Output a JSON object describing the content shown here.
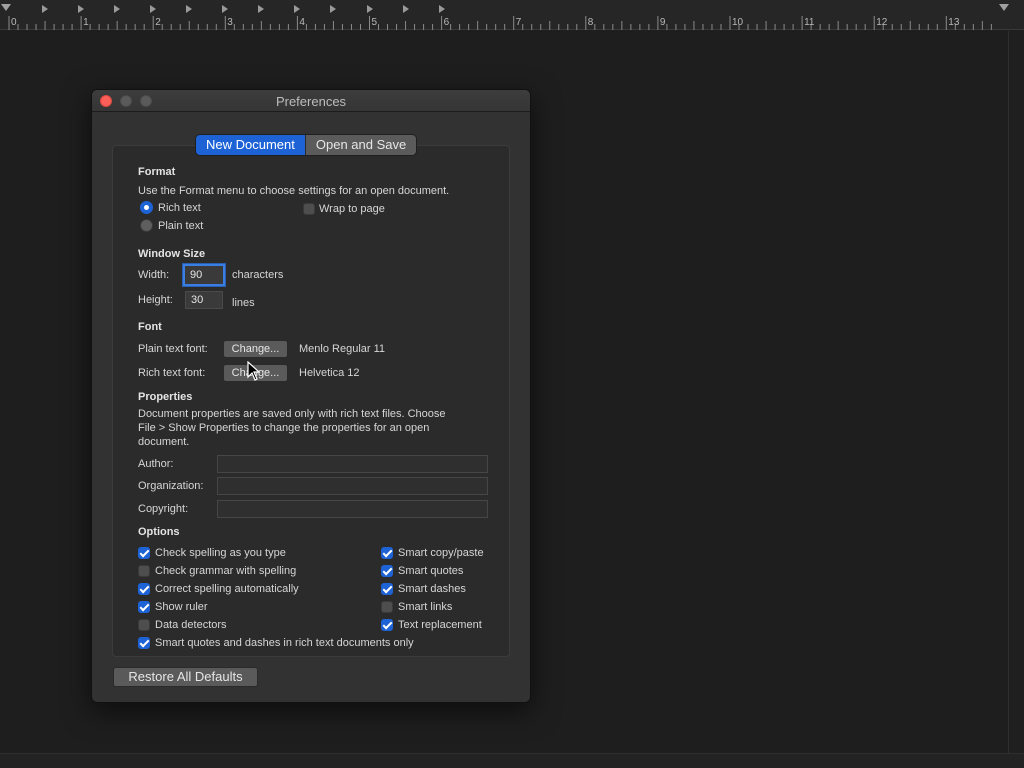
{
  "ruler": {
    "numbers": [
      "0",
      "1",
      "2",
      "3",
      "4",
      "5",
      "6",
      "7",
      "8",
      "9",
      "10",
      "11",
      "12",
      "13"
    ]
  },
  "document": {
    "text": ""
  },
  "prefs": {
    "title": "Preferences",
    "tabs": {
      "new_document": "New Document",
      "open_and_save": "Open and Save"
    },
    "format": {
      "heading": "Format",
      "description": "Use the Format menu to choose settings for an open document.",
      "rich_text": "Rich text",
      "plain_text": "Plain text",
      "wrap_to_page": "Wrap to page",
      "selected": "Rich text"
    },
    "window_size": {
      "heading": "Window Size",
      "width_label": "Width:",
      "width_value": "90",
      "width_unit": "characters",
      "height_label": "Height:",
      "height_value": "30",
      "height_unit": "lines"
    },
    "font": {
      "heading": "Font",
      "plain_label": "Plain text font:",
      "plain_button": "Change...",
      "plain_value": "Menlo Regular 11",
      "rich_label": "Rich text font:",
      "rich_button": "Change...",
      "rich_value": "Helvetica 12"
    },
    "properties": {
      "heading": "Properties",
      "description_1": "Document properties are saved only with rich text files. Choose",
      "description_2": "File > Show Properties to change the properties for an open",
      "description_3": "document.",
      "author_label": "Author:",
      "author_value": "",
      "organization_label": "Organization:",
      "organization_value": "",
      "copyright_label": "Copyright:",
      "copyright_value": ""
    },
    "options": {
      "heading": "Options",
      "check_spelling": "Check spelling as you type",
      "check_grammar": "Check grammar with spelling",
      "correct_spelling": "Correct spelling automatically",
      "show_ruler": "Show ruler",
      "data_detectors": "Data detectors",
      "smart_rich_only": "Smart quotes and dashes in rich text documents only",
      "smart_copy_paste": "Smart copy/paste",
      "smart_quotes": "Smart quotes",
      "smart_dashes": "Smart dashes",
      "smart_links": "Smart links",
      "text_replacement": "Text replacement"
    },
    "restore_button": "Restore All Defaults"
  },
  "colors": {
    "accent": "#1e63d6",
    "close_button": "#fc5f57",
    "window_bg": "#323232",
    "document_bg": "#1e1e1e"
  }
}
